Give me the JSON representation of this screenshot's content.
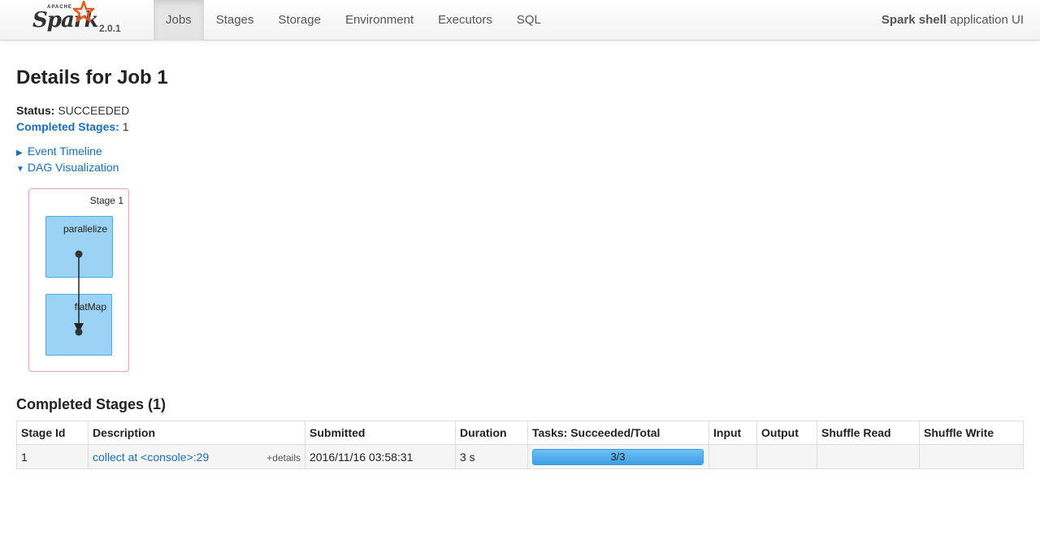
{
  "brand": {
    "apache": "APACHE",
    "name": "Spark",
    "version": "2.0.1"
  },
  "nav": {
    "items": [
      "Jobs",
      "Stages",
      "Storage",
      "Environment",
      "Executors",
      "SQL"
    ],
    "active": "Jobs"
  },
  "app_title": {
    "strong": "Spark shell",
    "rest": " application UI"
  },
  "page": {
    "title": "Details for Job 1",
    "status_label": "Status:",
    "status_value": "SUCCEEDED",
    "completed_label": "Completed Stages:",
    "completed_value": "1",
    "event_timeline": "Event Timeline",
    "dag_visualization": "DAG Visualization"
  },
  "dag": {
    "stage_label": "Stage 1",
    "nodes": [
      "parallelize",
      "flatMap"
    ]
  },
  "completed_section": {
    "title": "Completed Stages (1)",
    "columns": [
      "Stage Id",
      "Description",
      "Submitted",
      "Duration",
      "Tasks: Succeeded/Total",
      "Input",
      "Output",
      "Shuffle Read",
      "Shuffle Write"
    ],
    "rows": [
      {
        "stage_id": "1",
        "description": "collect at <console>:29",
        "details": "+details",
        "submitted": "2016/11/16 03:58:31",
        "duration": "3 s",
        "tasks": "3/3",
        "tasks_fraction": 1.0,
        "input": "",
        "output": "",
        "shuffle_read": "",
        "shuffle_write": ""
      }
    ]
  },
  "colors": {
    "link": "#1f6bb0",
    "stage_border": "#e8a0b9",
    "node_fill": "#9cd3f5",
    "progress": "#3e9fe6"
  }
}
